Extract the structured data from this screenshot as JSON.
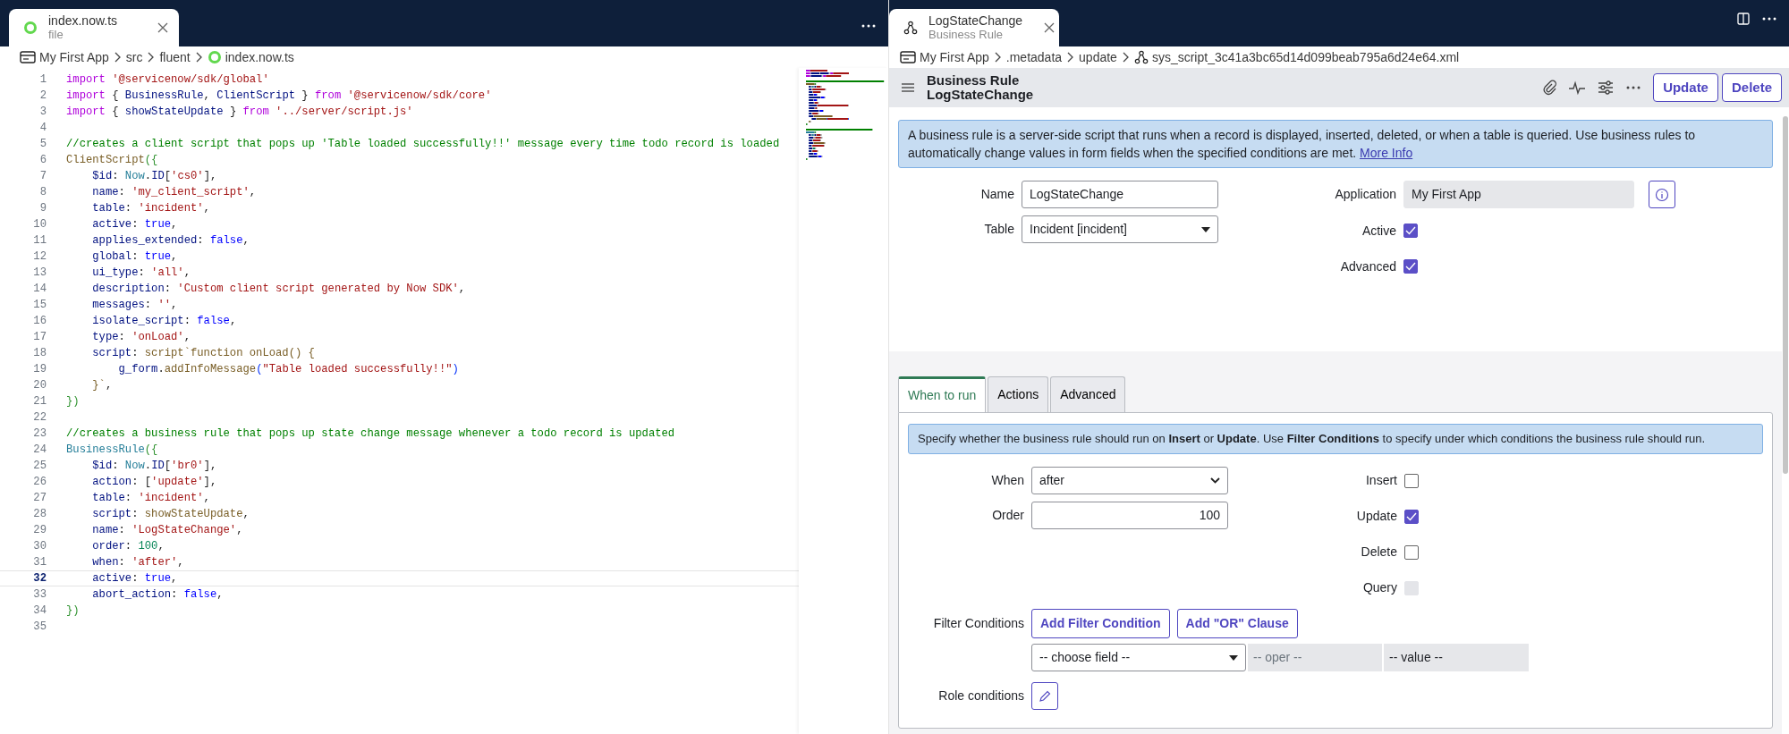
{
  "editor_tab": {
    "title": "index.now.ts",
    "subtitle": "file"
  },
  "left_breadcrumb": [
    "My First App",
    "src",
    "fluent",
    "index.now.ts"
  ],
  "code_lines": [
    {
      "number": "1",
      "current": false,
      "tokens": [
        {
          "kind": "kw",
          "text": "import "
        },
        {
          "kind": "str",
          "text": "'@servicenow/sdk/global'"
        }
      ]
    },
    {
      "number": "2",
      "current": false,
      "tokens": [
        {
          "kind": "kw",
          "text": "import "
        },
        {
          "kind": "punc",
          "text": "{ "
        },
        {
          "kind": "prop",
          "text": "BusinessRule"
        },
        {
          "kind": "punc",
          "text": ", "
        },
        {
          "kind": "prop",
          "text": "ClientScript"
        },
        {
          "kind": "punc",
          "text": " } "
        },
        {
          "kind": "kw",
          "text": "from "
        },
        {
          "kind": "str",
          "text": "'@servicenow/sdk/core'"
        }
      ]
    },
    {
      "number": "3",
      "current": false,
      "tokens": [
        {
          "kind": "kw",
          "text": "import "
        },
        {
          "kind": "punc",
          "text": "{ "
        },
        {
          "kind": "prop",
          "text": "showStateUpdate"
        },
        {
          "kind": "punc",
          "text": " } "
        },
        {
          "kind": "kw",
          "text": "from "
        },
        {
          "kind": "str",
          "text": "'../server/script.js'"
        }
      ]
    },
    {
      "number": "4",
      "current": false
    },
    {
      "number": "5",
      "current": false,
      "tokens": [
        {
          "kind": "cmt",
          "text": "//creates a client script that pops up 'Table loaded successfully!!' message every time todo record is loaded"
        }
      ]
    },
    {
      "number": "6",
      "current": false,
      "tokens": [
        {
          "kind": "fn",
          "text": "ClientScript"
        },
        {
          "kind": "brk",
          "text": "({"
        }
      ]
    },
    {
      "number": "7",
      "current": false,
      "tokens": [
        {
          "kind": "prop",
          "text": "    $id"
        },
        {
          "kind": "punc",
          "text": ": "
        },
        {
          "kind": "type",
          "text": "Now"
        },
        {
          "kind": "punc",
          "text": "."
        },
        {
          "kind": "prop",
          "text": "ID"
        },
        {
          "kind": "punc",
          "text": "["
        },
        {
          "kind": "str",
          "text": "'cs0'"
        },
        {
          "kind": "punc",
          "text": "],"
        }
      ]
    },
    {
      "number": "8",
      "current": false,
      "tokens": [
        {
          "kind": "prop",
          "text": "    name"
        },
        {
          "kind": "punc",
          "text": ": "
        },
        {
          "kind": "str",
          "text": "'my_client_script'"
        },
        {
          "kind": "punc",
          "text": ","
        }
      ]
    },
    {
      "number": "9",
      "current": false,
      "tokens": [
        {
          "kind": "prop",
          "text": "    table"
        },
        {
          "kind": "punc",
          "text": ": "
        },
        {
          "kind": "str",
          "text": "'incident'"
        },
        {
          "kind": "punc",
          "text": ","
        }
      ]
    },
    {
      "number": "10",
      "current": false,
      "tokens": [
        {
          "kind": "prop",
          "text": "    active"
        },
        {
          "kind": "punc",
          "text": ": "
        },
        {
          "kind": "bool",
          "text": "true"
        },
        {
          "kind": "punc",
          "text": ","
        }
      ]
    },
    {
      "number": "11",
      "current": false,
      "tokens": [
        {
          "kind": "prop",
          "text": "    applies_extended"
        },
        {
          "kind": "punc",
          "text": ": "
        },
        {
          "kind": "bool",
          "text": "false"
        },
        {
          "kind": "punc",
          "text": ","
        }
      ]
    },
    {
      "number": "12",
      "current": false,
      "tokens": [
        {
          "kind": "prop",
          "text": "    global"
        },
        {
          "kind": "punc",
          "text": ": "
        },
        {
          "kind": "bool",
          "text": "true"
        },
        {
          "kind": "punc",
          "text": ","
        }
      ]
    },
    {
      "number": "13",
      "current": false,
      "tokens": [
        {
          "kind": "prop",
          "text": "    ui_type"
        },
        {
          "kind": "punc",
          "text": ": "
        },
        {
          "kind": "str",
          "text": "'all'"
        },
        {
          "kind": "punc",
          "text": ","
        }
      ]
    },
    {
      "number": "14",
      "current": false,
      "tokens": [
        {
          "kind": "prop",
          "text": "    description"
        },
        {
          "kind": "punc",
          "text": ": "
        },
        {
          "kind": "str",
          "text": "'Custom client script generated by Now SDK'"
        },
        {
          "kind": "punc",
          "text": ","
        }
      ]
    },
    {
      "number": "15",
      "current": false,
      "tokens": [
        {
          "kind": "prop",
          "text": "    messages"
        },
        {
          "kind": "punc",
          "text": ": "
        },
        {
          "kind": "str",
          "text": "''"
        },
        {
          "kind": "punc",
          "text": ","
        }
      ]
    },
    {
      "number": "16",
      "current": false,
      "tokens": [
        {
          "kind": "prop",
          "text": "    isolate_script"
        },
        {
          "kind": "punc",
          "text": ": "
        },
        {
          "kind": "bool",
          "text": "false"
        },
        {
          "kind": "punc",
          "text": ","
        }
      ]
    },
    {
      "number": "17",
      "current": false,
      "tokens": [
        {
          "kind": "prop",
          "text": "    type"
        },
        {
          "kind": "punc",
          "text": ": "
        },
        {
          "kind": "str",
          "text": "'onLoad'"
        },
        {
          "kind": "punc",
          "text": ","
        }
      ]
    },
    {
      "number": "18",
      "current": false,
      "tokens": [
        {
          "kind": "prop",
          "text": "    script"
        },
        {
          "kind": "punc",
          "text": ": "
        },
        {
          "kind": "fn",
          "text": "script`function onLoad() {"
        }
      ]
    },
    {
      "number": "19",
      "current": false,
      "tokens": [
        {
          "kind": "prop",
          "text": "        g_form"
        },
        {
          "kind": "punc",
          "text": "."
        },
        {
          "kind": "fn",
          "text": "addInfoMessage"
        },
        {
          "kind": "brk2",
          "text": "("
        },
        {
          "kind": "str",
          "text": "\"Table loaded successfully!!\""
        },
        {
          "kind": "brk2",
          "text": ")"
        }
      ]
    },
    {
      "number": "20",
      "current": false,
      "tokens": [
        {
          "kind": "fn",
          "text": "    }`"
        },
        {
          "kind": "punc",
          "text": ","
        }
      ]
    },
    {
      "number": "21",
      "current": false,
      "tokens": [
        {
          "kind": "brk",
          "text": "})"
        }
      ]
    },
    {
      "number": "22",
      "current": false
    },
    {
      "number": "23",
      "current": false,
      "tokens": [
        {
          "kind": "cmt",
          "text": "//creates a business rule that pops up state change message whenever a todo record is updated"
        }
      ]
    },
    {
      "number": "24",
      "current": false,
      "tokens": [
        {
          "kind": "type",
          "text": "BusinessRule"
        },
        {
          "kind": "brk",
          "text": "({"
        }
      ]
    },
    {
      "number": "25",
      "current": false,
      "tokens": [
        {
          "kind": "prop",
          "text": "    $id"
        },
        {
          "kind": "punc",
          "text": ": "
        },
        {
          "kind": "type",
          "text": "Now"
        },
        {
          "kind": "punc",
          "text": "."
        },
        {
          "kind": "prop",
          "text": "ID"
        },
        {
          "kind": "punc",
          "text": "["
        },
        {
          "kind": "str",
          "text": "'br0'"
        },
        {
          "kind": "punc",
          "text": "],"
        }
      ]
    },
    {
      "number": "26",
      "current": false,
      "tokens": [
        {
          "kind": "prop",
          "text": "    action"
        },
        {
          "kind": "punc",
          "text": ": ["
        },
        {
          "kind": "str",
          "text": "'update'"
        },
        {
          "kind": "punc",
          "text": "],"
        }
      ]
    },
    {
      "number": "27",
      "current": false,
      "tokens": [
        {
          "kind": "prop",
          "text": "    table"
        },
        {
          "kind": "punc",
          "text": ": "
        },
        {
          "kind": "str",
          "text": "'incident'"
        },
        {
          "kind": "punc",
          "text": ","
        }
      ]
    },
    {
      "number": "28",
      "current": false,
      "tokens": [
        {
          "kind": "prop",
          "text": "    script"
        },
        {
          "kind": "punc",
          "text": ": "
        },
        {
          "kind": "fn",
          "text": "showStateUpdate"
        },
        {
          "kind": "punc",
          "text": ","
        }
      ]
    },
    {
      "number": "29",
      "current": false,
      "tokens": [
        {
          "kind": "prop",
          "text": "    name"
        },
        {
          "kind": "punc",
          "text": ": "
        },
        {
          "kind": "str",
          "text": "'LogStateChange'"
        },
        {
          "kind": "punc",
          "text": ","
        }
      ]
    },
    {
      "number": "30",
      "current": false,
      "tokens": [
        {
          "kind": "prop",
          "text": "    order"
        },
        {
          "kind": "punc",
          "text": ": "
        },
        {
          "kind": "num",
          "text": "100"
        },
        {
          "kind": "punc",
          "text": ","
        }
      ]
    },
    {
      "number": "31",
      "current": false,
      "tokens": [
        {
          "kind": "prop",
          "text": "    when"
        },
        {
          "kind": "punc",
          "text": ": "
        },
        {
          "kind": "str",
          "text": "'after'"
        },
        {
          "kind": "punc",
          "text": ","
        }
      ]
    },
    {
      "number": "32",
      "current": true,
      "tokens": [
        {
          "kind": "prop",
          "text": "    active"
        },
        {
          "kind": "punc",
          "text": ": "
        },
        {
          "kind": "bool",
          "text": "true"
        },
        {
          "kind": "punc",
          "text": ","
        }
      ]
    },
    {
      "number": "33",
      "current": false,
      "tokens": [
        {
          "kind": "prop",
          "text": "    abort_action"
        },
        {
          "kind": "punc",
          "text": ": "
        },
        {
          "kind": "bool",
          "text": "false"
        },
        {
          "kind": "punc",
          "text": ","
        }
      ]
    },
    {
      "number": "34",
      "current": false,
      "tokens": [
        {
          "kind": "brk",
          "text": "})"
        }
      ]
    },
    {
      "number": "35",
      "current": false
    }
  ],
  "record_tab": {
    "title": "LogStateChange",
    "subtitle": "Business Rule"
  },
  "right_breadcrumb": [
    "My First App",
    ".metadata",
    "update",
    "sys_script_3c41a3bc65d14d099beab795a6d24e64.xml"
  ],
  "form_header": {
    "type": "Business Rule",
    "name": "LogStateChange",
    "buttons": [
      "Update",
      "Delete"
    ]
  },
  "info": {
    "text": "A business rule is a server-side script that runs when a record is displayed, inserted, deleted, or when a table is queried. Use business rules to automatically change values in form fields when the specified conditions are met.",
    "link": "More Info"
  },
  "fields": [
    {
      "label": "Name",
      "kind": "text",
      "value": "LogStateChange"
    },
    {
      "label": "Table",
      "kind": "dropdown",
      "value": "Incident [incident]"
    }
  ],
  "application": {
    "label": "Application",
    "value": "My First App"
  },
  "flags": [
    {
      "label": "Active",
      "checked": true,
      "disabled": false
    },
    {
      "label": "Advanced",
      "checked": true,
      "disabled": false
    }
  ],
  "section_tabs": [
    {
      "label": "When to run",
      "selected": true
    },
    {
      "label": "Actions",
      "selected": false
    },
    {
      "label": "Advanced",
      "selected": false
    }
  ],
  "section_info": "Specify whether the business rule should run on **Insert** or **Update**. Use **Filter Conditions** to specify under which conditions the business rule should run.",
  "when_fields": [
    {
      "label": "When",
      "kind": "select",
      "value": "after"
    },
    {
      "label": "Order",
      "kind": "number",
      "value": "100"
    }
  ],
  "operations": [
    {
      "label": "Insert",
      "checked": false,
      "disabled": false
    },
    {
      "label": "Update",
      "checked": true,
      "disabled": false
    },
    {
      "label": "Delete",
      "checked": false,
      "disabled": false
    },
    {
      "label": "Query",
      "checked": false,
      "disabled": true
    }
  ],
  "filter": {
    "label": "Filter Conditions",
    "buttons": [
      "Add Filter Condition",
      "Add \"OR\" Clause"
    ],
    "field": "-- choose field --",
    "operator": "-- oper --",
    "value": "-- value --"
  },
  "role_conditions": {
    "label": "Role conditions"
  }
}
